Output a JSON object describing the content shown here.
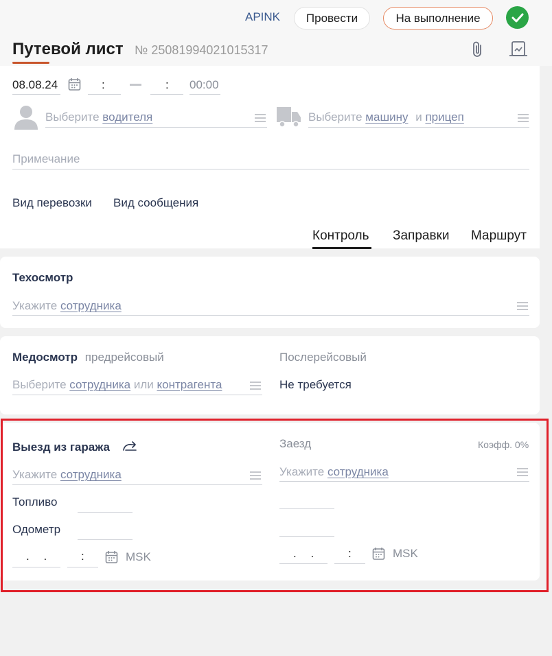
{
  "header": {
    "org_label": "APINK",
    "post_button": "Провести",
    "status_button": "На выполнение",
    "title": "Путевой лист",
    "doc_number_prefix": "№",
    "doc_number": "25081994021015317"
  },
  "datetime": {
    "date": "08.08.24",
    "time_from": ":",
    "time_to": ":",
    "duration": "00:00"
  },
  "driver": {
    "prefix": "Выберите",
    "link": "водителя"
  },
  "vehicle": {
    "prefix": "Выберите",
    "link": "машину",
    "and": "и",
    "trailer_link": "прицеп"
  },
  "note": {
    "placeholder": "Примечание"
  },
  "transport": {
    "type_label": "Вид перевозки",
    "message_label": "Вид сообщения"
  },
  "tabs": [
    {
      "label": "Контроль",
      "active": true
    },
    {
      "label": "Заправки",
      "active": false
    },
    {
      "label": "Маршрут",
      "active": false
    }
  ],
  "tech_inspection": {
    "title": "Техосмотр",
    "prefix": "Укажите",
    "link": "сотрудника"
  },
  "med_inspection": {
    "title": "Медосмотр",
    "subtitle": "предрейсовый",
    "prefix": "Выберите",
    "link1": "сотрудника",
    "or": "или",
    "link2": "контрагента",
    "post_label": "Послерейсовый",
    "post_value": "Не требуется"
  },
  "departure": {
    "title": "Выезд из гаража",
    "prefix": "Укажите",
    "link": "сотрудника",
    "fuel_label": "Топливо",
    "odometer_label": "Одометр",
    "date_placeholder": ". .",
    "time_placeholder": ":",
    "timezone": "MSK"
  },
  "arrival": {
    "title": "Заезд",
    "coeff": "Коэфф. 0%",
    "prefix": "Укажите",
    "link": "сотрудника",
    "date_placeholder": ". .",
    "time_placeholder": ":",
    "timezone": "MSK"
  },
  "colors": {
    "accent_orange": "#c8552c",
    "success_green": "#2aa546",
    "link_blue": "#3b5a8f",
    "highlight_red": "#e0202a"
  }
}
